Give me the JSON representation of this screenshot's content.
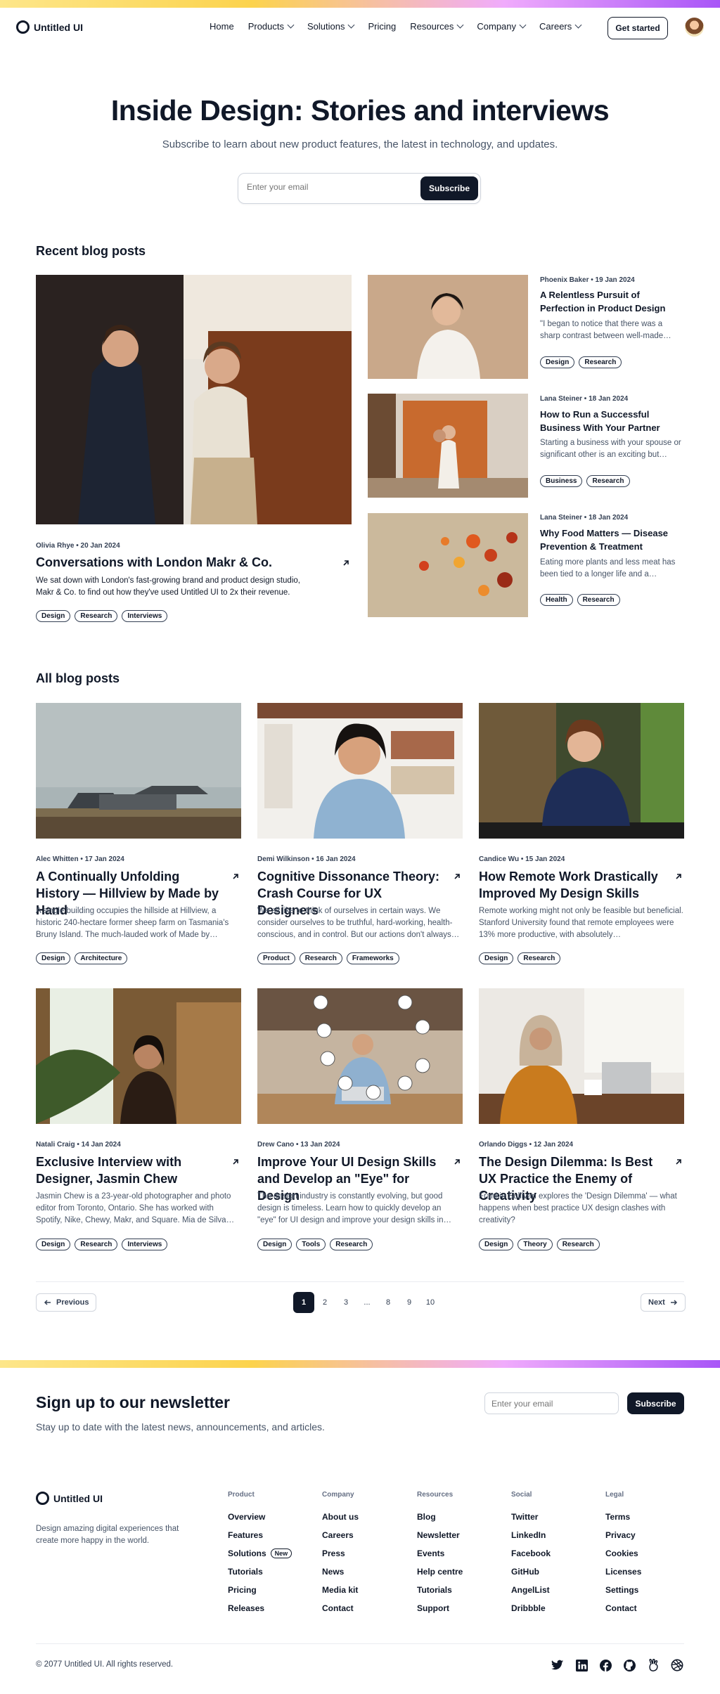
{
  "brand": "Untitled UI",
  "nav": {
    "items": [
      "Home",
      "Products",
      "Solutions",
      "Pricing",
      "Resources",
      "Company",
      "Careers"
    ],
    "get_started": "Get started"
  },
  "hero": {
    "title": "Inside Design: Stories and interviews",
    "subtitle": "Subscribe to learn about new product features, the latest in technology, and updates.",
    "email_placeholder": "Enter your email",
    "subscribe": "Subscribe"
  },
  "recent": {
    "title": "Recent blog posts",
    "featured": {
      "meta": "Olivia Rhye • 20 Jan 2024",
      "title": "Conversations with London Makr & Co.",
      "desc": "We sat down with London's fast-growing brand and product design studio, Makr & Co. to find out how they've used Untitled UI to 2x their revenue.",
      "tags": [
        "Design",
        "Research",
        "Interviews"
      ]
    },
    "side": [
      {
        "meta": "Phoenix Baker • 19 Jan 2024",
        "title": "A Relentless Pursuit of Perfection in Product Design",
        "desc": "\"I began to notice that there was a sharp contrast between well-made…",
        "tags": [
          "Design",
          "Research"
        ]
      },
      {
        "meta": "Lana Steiner • 18 Jan 2024",
        "title": "How to Run a Successful Business With Your Partner",
        "desc": "Starting a business with your spouse or significant other is an exciting but…",
        "tags": [
          "Business",
          "Research"
        ]
      },
      {
        "meta": "Lana Steiner • 18 Jan 2024",
        "title": "Why Food Matters — Disease Prevention & Treatment",
        "desc": "Eating more plants and less meat has been tied to a longer life and a…",
        "tags": [
          "Health",
          "Research"
        ]
      }
    ]
  },
  "all": {
    "title": "All blog posts",
    "posts": [
      {
        "meta": "Alec Whitten • 17 Jan 2024",
        "title": "A Continually Unfolding History — Hillview by Made by Hand",
        "desc": "A single building occupies the hillside at Hillview, a historic 240-hectare former sheep farm on Tasmania's Bruny Island. The much-lauded work of Made by…",
        "tags": [
          "Design",
          "Architecture"
        ]
      },
      {
        "meta": "Demi Wilkinson • 16 Jan 2024",
        "title": "Cognitive Dissonance Theory: Crash Course for UX Designers",
        "desc": "We all like to think of ourselves in certain ways. We consider ourselves to be truthful, hard-working, health-conscious, and in control. But our actions don't always…",
        "tags": [
          "Product",
          "Research",
          "Frameworks"
        ]
      },
      {
        "meta": "Candice Wu • 15 Jan 2024",
        "title": "How Remote Work Drastically Improved My Design Skills",
        "desc": "Remote working might not only be feasible but beneficial. Stanford University found that remote employees were 13% more productive, with absolutely…",
        "tags": [
          "Design",
          "Research"
        ]
      },
      {
        "meta": "Natali Craig • 14 Jan 2024",
        "title": "Exclusive Interview with Designer, Jasmin Chew",
        "desc": "Jasmin Chew is a 23-year-old photographer and photo editor from Toronto, Ontario. She has worked with Spotify, Nike, Chewy, Makr, and Square. Mia de Silva…",
        "tags": [
          "Design",
          "Research",
          "Interviews"
        ]
      },
      {
        "meta": "Drew Cano • 13 Jan 2024",
        "title": "Improve Your UI Design Skills and Develop an \"Eye\" for Design",
        "desc": "The design industry is constantly evolving, but good design is timeless. Learn how to quickly develop an \"eye\" for UI design and improve your design skills in…",
        "tags": [
          "Design",
          "Tools",
          "Research"
        ]
      },
      {
        "meta": "Orlando Diggs • 12 Jan 2024",
        "title": "The Design Dilemma: Is Best UX Practice the Enemy of Creativity",
        "desc": "Frankie Sullivan explores the 'Design Dilemma' — what happens when best practice UX design clashes with creativity?",
        "tags": [
          "Design",
          "Theory",
          "Research"
        ]
      }
    ]
  },
  "pagination": {
    "previous": "Previous",
    "next": "Next",
    "pages": [
      "1",
      "2",
      "3",
      "...",
      "8",
      "9",
      "10"
    ],
    "current": "1"
  },
  "newsletter": {
    "title": "Sign up to our newsletter",
    "subtitle": "Stay up to date with the latest news, announcements, and articles.",
    "placeholder": "Enter your email",
    "button": "Subscribe"
  },
  "footer": {
    "tagline": "Design amazing digital experiences that create more happy in the world.",
    "columns": [
      {
        "heading": "Product",
        "links": [
          "Overview",
          "Features",
          "Solutions",
          "Tutorials",
          "Pricing",
          "Releases"
        ],
        "badge": "New"
      },
      {
        "heading": "Company",
        "links": [
          "About us",
          "Careers",
          "Press",
          "News",
          "Media kit",
          "Contact"
        ]
      },
      {
        "heading": "Resources",
        "links": [
          "Blog",
          "Newsletter",
          "Events",
          "Help centre",
          "Tutorials",
          "Support"
        ]
      },
      {
        "heading": "Social",
        "links": [
          "Twitter",
          "LinkedIn",
          "Facebook",
          "GitHub",
          "AngelList",
          "Dribbble"
        ]
      },
      {
        "heading": "Legal",
        "links": [
          "Terms",
          "Privacy",
          "Cookies",
          "Licenses",
          "Settings",
          "Contact"
        ]
      }
    ],
    "copyright": "© 2077 Untitled UI. All rights reserved.",
    "social_icons": [
      "twitter-icon",
      "linkedin-icon",
      "facebook-icon",
      "github-icon",
      "angellist-icon",
      "dribbble-icon"
    ]
  }
}
